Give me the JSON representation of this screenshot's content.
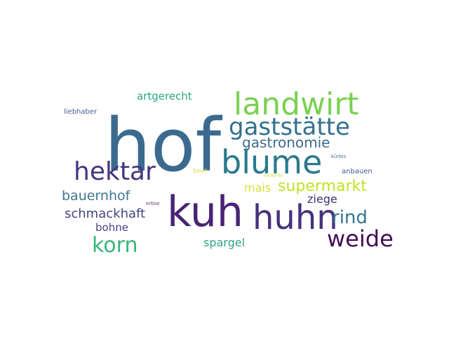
{
  "words": [
    {
      "text": "hof",
      "color": "#3b6a8e"
    },
    {
      "text": "landwirt",
      "color": "#7ad151"
    },
    {
      "text": "gaststätte",
      "color": "#33718d"
    },
    {
      "text": "blume",
      "color": "#2a7a8e"
    },
    {
      "text": "hektar",
      "color": "#45347f"
    },
    {
      "text": "kuh",
      "color": "#482474"
    },
    {
      "text": "huhn",
      "color": "#46317e"
    },
    {
      "text": "weide",
      "color": "#440d54"
    },
    {
      "text": "gastronomie",
      "color": "#3e6b8d"
    },
    {
      "text": "supermarkt",
      "color": "#c4df24"
    },
    {
      "text": "bauernhof",
      "color": "#3f7790"
    },
    {
      "text": "korn",
      "color": "#3ab67a"
    },
    {
      "text": "rind",
      "color": "#35768e"
    },
    {
      "text": "schmackhaft",
      "color": "#45437f"
    },
    {
      "text": "artgerecht",
      "color": "#29a787"
    },
    {
      "text": "mais",
      "color": "#d9e03a"
    },
    {
      "text": "ziege",
      "color": "#3d2f7a"
    },
    {
      "text": "bohne",
      "color": "#4c3e86"
    },
    {
      "text": "spargel",
      "color": "#2ea486"
    },
    {
      "text": "liebhaber",
      "color": "#4d5a8a"
    },
    {
      "text": "anbauen",
      "color": "#3e5c8c"
    },
    {
      "text": "beet",
      "color": "#d7e24a"
    },
    {
      "text": "kürbis",
      "color": "#4b6f97"
    },
    {
      "text": "erbse",
      "color": "#6a3e7e"
    },
    {
      "text": "leckerei",
      "color": "#cde14a"
    }
  ]
}
